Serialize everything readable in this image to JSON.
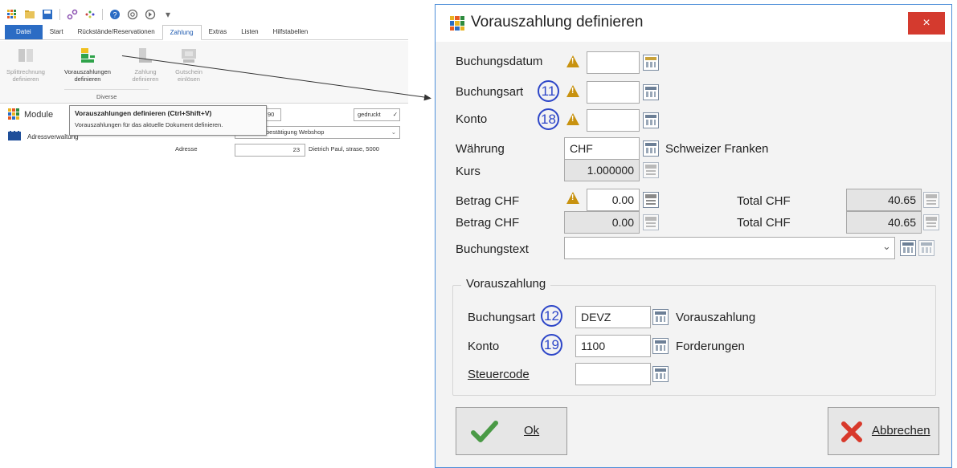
{
  "ribbon_tabs": [
    "Datei",
    "Start",
    "Rückstände/Reservationen",
    "Zahlung",
    "Extras",
    "Listen",
    "Hilfstabellen"
  ],
  "ribbon_buttons": [
    {
      "line1": "Splittrechnung",
      "line2": "definieren"
    },
    {
      "line1": "Vorauszahlungen",
      "line2": "definieren"
    },
    {
      "line1": "Zahlung",
      "line2": "definieren"
    },
    {
      "line1": "Gutschein",
      "line2": "einlösen"
    }
  ],
  "ribbon_group": "Diverse",
  "modules_label": "Module",
  "adressverwaltung": "Adressverwaltung",
  "tooltip": {
    "title": "Vorauszahlungen definieren (Ctrl+Shift+V)",
    "text": "Vorauszahlungen für das aktuelle Dokument definieren."
  },
  "background": {
    "field_value": "90",
    "gedruckt": "gedruckt",
    "bestaetigung": "bestätigung Webshop",
    "adresse_label": "Adresse",
    "adresse_num": "23",
    "adresse_value": "Dietrich Paul, strase, 5000"
  },
  "dialog": {
    "title": "Vorauszahlung definieren",
    "close": "×",
    "labels": {
      "buchungsdatum": "Buchungsdatum",
      "buchungsart": "Buchungsart",
      "konto": "Konto",
      "waehrung": "Währung",
      "kurs": "Kurs",
      "betrag1": "Betrag CHF",
      "betrag2": "Betrag CHF",
      "total1": "Total CHF",
      "total2": "Total CHF",
      "buchungstext": "Buchungstext"
    },
    "values": {
      "buchungsdatum": "",
      "buchungsart": "",
      "konto": "",
      "waehrung": "CHF",
      "waehrung_desc": "Schweizer Franken",
      "kurs": "1.000000",
      "betrag1": "0.00",
      "betrag2": "0.00",
      "total1": "40.65",
      "total2": "40.65",
      "buchungstext": ""
    },
    "callouts": {
      "buchungsart": "11",
      "konto": "18",
      "vz_buchungsart": "12",
      "vz_konto": "19"
    },
    "vorauszahlung": {
      "legend": "Vorauszahlung",
      "buchungsart_label": "Buchungsart",
      "buchungsart_value": "DEVZ",
      "buchungsart_desc": "Vorauszahlung",
      "konto_label": "Konto",
      "konto_value": "1100",
      "konto_desc": "Forderungen",
      "steuercode_label": "Steuercode",
      "steuercode_value": ""
    },
    "buttons": {
      "ok": "Ok",
      "cancel": "Abbrechen"
    }
  },
  "colors": {
    "accent": "#2b6cc4",
    "close": "#d43a2e",
    "warning": "#c8920f",
    "callout": "#2d46c8",
    "ok_check": "#4a9a46",
    "cancel_x": "#d8392b"
  }
}
